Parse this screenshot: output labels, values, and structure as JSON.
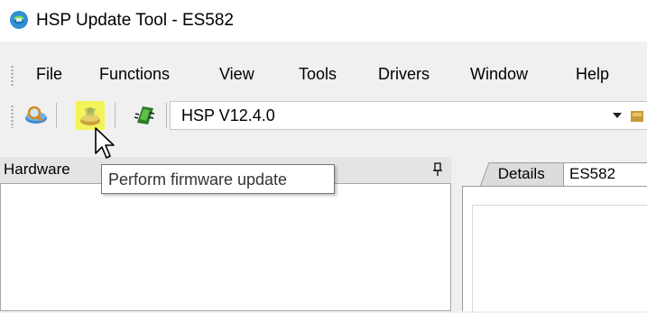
{
  "window": {
    "title": "HSP Update Tool - ES582",
    "app_icon": "hsp-update-icon"
  },
  "menu": {
    "items": [
      {
        "label": "File"
      },
      {
        "label": "Functions"
      },
      {
        "label": "View"
      },
      {
        "label": "Tools"
      },
      {
        "label": "Drivers"
      },
      {
        "label": "Window"
      },
      {
        "label": "Help"
      }
    ]
  },
  "toolbar": {
    "buttons": [
      {
        "icon": "search-hardware-icon"
      },
      {
        "icon": "firmware-update-icon",
        "highlight_color": "#f3f35a"
      },
      {
        "icon": "green-chip-icon"
      }
    ],
    "version_selector": {
      "value": "HSP V12.4.0"
    }
  },
  "left_panel": {
    "header_label": "Hardware",
    "pin_icon": "pin-icon"
  },
  "right_panel": {
    "tabs": [
      {
        "label": "Details"
      },
      {
        "label": "ES582"
      }
    ]
  },
  "tooltip": {
    "text": "Perform firmware update"
  },
  "colors": {
    "highlight": "#f3f35a",
    "window_bg": "#f0f0f0",
    "panel_header_bg": "#e4e4e4"
  }
}
